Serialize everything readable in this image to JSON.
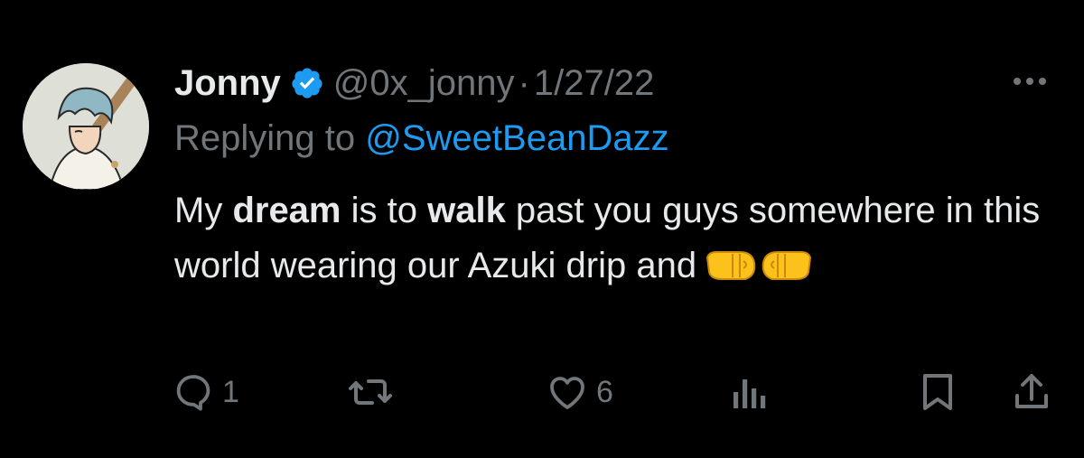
{
  "tweet": {
    "author": {
      "display_name": "Jonny",
      "handle": "@0x_jonny",
      "verified": true
    },
    "separator": "·",
    "date": "1/27/22",
    "replying_prefix": "Replying to",
    "replying_to": "@SweetBeanDazz",
    "text": {
      "part1": "My ",
      "bold1": "dream",
      "part2": " is to ",
      "bold2": "walk",
      "part3": " past you guys somewhere in this world wearing our Azuki drip and",
      "emoji_names": [
        "left-facing-fist",
        "right-facing-fist"
      ]
    },
    "actions": {
      "reply_count": "1",
      "retweet_count": "",
      "like_count": "6"
    }
  },
  "colors": {
    "background": "#000000",
    "text_primary": "#e7e9ea",
    "text_secondary": "#71767b",
    "accent": "#1d9bf0"
  }
}
